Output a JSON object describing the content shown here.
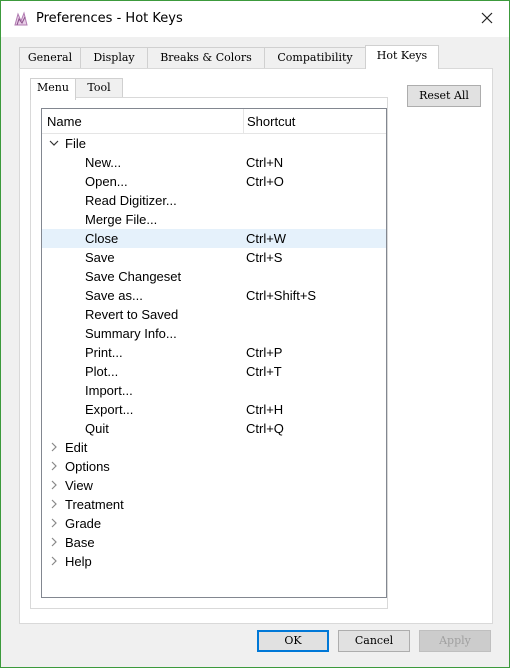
{
  "window": {
    "title": "Preferences - Hot Keys"
  },
  "tabs": [
    "General",
    "Display",
    "Breaks & Colors",
    "Compatibility",
    "Hot Keys"
  ],
  "subtabs": [
    "Menu",
    "Tool"
  ],
  "reset_all": "Reset All",
  "columns": {
    "name": "Name",
    "shortcut": "Shortcut"
  },
  "tree": {
    "file": {
      "label": "File",
      "items": [
        {
          "label": "New...",
          "shortcut": "Ctrl+N"
        },
        {
          "label": "Open...",
          "shortcut": "Ctrl+O"
        },
        {
          "label": "Read Digitizer...",
          "shortcut": ""
        },
        {
          "label": "Merge File...",
          "shortcut": ""
        },
        {
          "label": "Close",
          "shortcut": "Ctrl+W"
        },
        {
          "label": "Save",
          "shortcut": "Ctrl+S"
        },
        {
          "label": "Save Changeset",
          "shortcut": ""
        },
        {
          "label": "Save as...",
          "shortcut": "Ctrl+Shift+S"
        },
        {
          "label": "Revert to Saved",
          "shortcut": ""
        },
        {
          "label": "Summary Info...",
          "shortcut": ""
        },
        {
          "label": "Print...",
          "shortcut": "Ctrl+P"
        },
        {
          "label": "Plot...",
          "shortcut": "Ctrl+T"
        },
        {
          "label": "Import...",
          "shortcut": ""
        },
        {
          "label": "Export...",
          "shortcut": "Ctrl+H"
        },
        {
          "label": "Quit",
          "shortcut": "Ctrl+Q"
        }
      ]
    },
    "groups": [
      "Edit",
      "Options",
      "View",
      "Treatment",
      "Grade",
      "Base",
      "Help"
    ]
  },
  "buttons": {
    "ok": "OK",
    "cancel": "Cancel",
    "apply": "Apply"
  },
  "colors": {
    "window_border": "#3c9a3c",
    "selection": "#e5f1fb",
    "default_button_border": "#0078d7"
  }
}
